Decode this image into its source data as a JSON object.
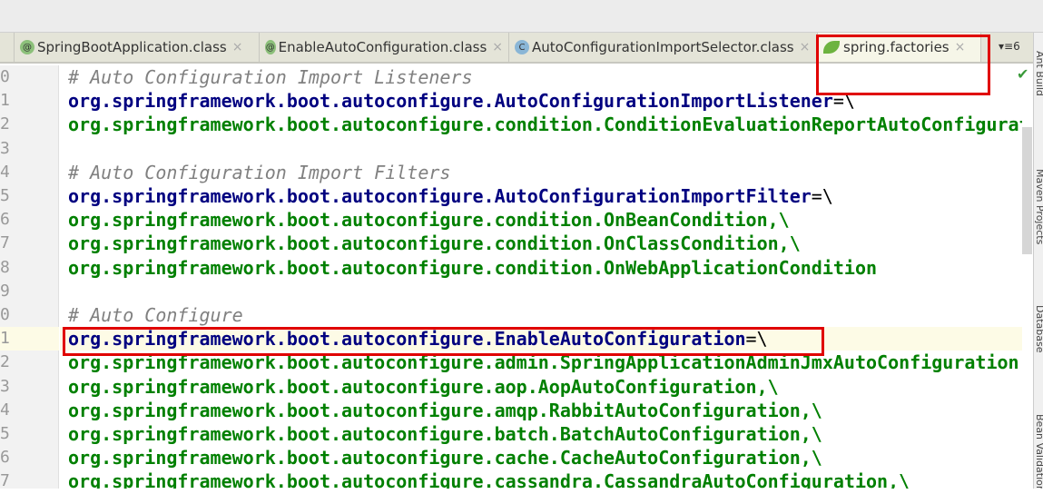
{
  "tabs": [
    {
      "label": "SpringBootApplication.class",
      "icon": "annotation-icon",
      "glyph": "@"
    },
    {
      "label": "EnableAutoConfiguration.class",
      "icon": "annotation-icon",
      "glyph": "@"
    },
    {
      "label": "AutoConfigurationImportSelector.class",
      "icon": "class-icon",
      "glyph": "C"
    },
    {
      "label": "spring.factories",
      "icon": "spring-leaf-icon",
      "active": true
    }
  ],
  "tab_overflow": "▾≡6",
  "close_glyph": "×",
  "check_glyph": "✔",
  "line_numbers": [
    "0",
    "1",
    "2",
    "3",
    "4",
    "5",
    "6",
    "7",
    "8",
    "9",
    "0",
    "1",
    "2",
    "3",
    "4",
    "5",
    "6",
    "7"
  ],
  "lines": [
    {
      "type": "comment",
      "text": "# Auto Configuration Import Listeners"
    },
    {
      "type": "key",
      "text": "org.springframework.boot.autoconfigure.AutoConfigurationImportListener",
      "suffix": "=\\"
    },
    {
      "type": "val",
      "text": "org.springframework.boot.autoconfigure.condition.ConditionEvaluationReportAutoConfiguration"
    },
    {
      "type": "blank",
      "text": ""
    },
    {
      "type": "comment",
      "text": "# Auto Configuration Import Filters"
    },
    {
      "type": "key",
      "text": "org.springframework.boot.autoconfigure.AutoConfigurationImportFilter",
      "suffix": "=\\"
    },
    {
      "type": "val",
      "text": "org.springframework.boot.autoconfigure.condition.OnBeanCondition,\\"
    },
    {
      "type": "val",
      "text": "org.springframework.boot.autoconfigure.condition.OnClassCondition,\\"
    },
    {
      "type": "val",
      "text": "org.springframework.boot.autoconfigure.condition.OnWebApplicationCondition"
    },
    {
      "type": "blank",
      "text": ""
    },
    {
      "type": "comment",
      "text": "# Auto Configure"
    },
    {
      "type": "key",
      "text": "org.springframework.boot.autoconfigure.EnableAutoConfiguration",
      "suffix": "=\\",
      "highlight": true
    },
    {
      "type": "val",
      "text": "org.springframework.boot.autoconfigure.admin.SpringApplicationAdminJmxAutoConfiguration,\\"
    },
    {
      "type": "val",
      "text": "org.springframework.boot.autoconfigure.aop.AopAutoConfiguration,\\"
    },
    {
      "type": "val",
      "text": "org.springframework.boot.autoconfigure.amqp.RabbitAutoConfiguration,\\"
    },
    {
      "type": "val",
      "text": "org.springframework.boot.autoconfigure.batch.BatchAutoConfiguration,\\"
    },
    {
      "type": "val",
      "text": "org.springframework.boot.autoconfigure.cache.CacheAutoConfiguration,\\"
    },
    {
      "type": "val",
      "text": "org.springframework.boot.autoconfigure.cassandra.CassandraAutoConfiguration,\\"
    }
  ],
  "side_panels": [
    "Ant Build",
    "Maven Projects",
    "Database",
    "Bean Validation"
  ],
  "colors": {
    "key": "#000080",
    "value": "#008000",
    "comment": "#808080",
    "annotation": "#e00000"
  }
}
